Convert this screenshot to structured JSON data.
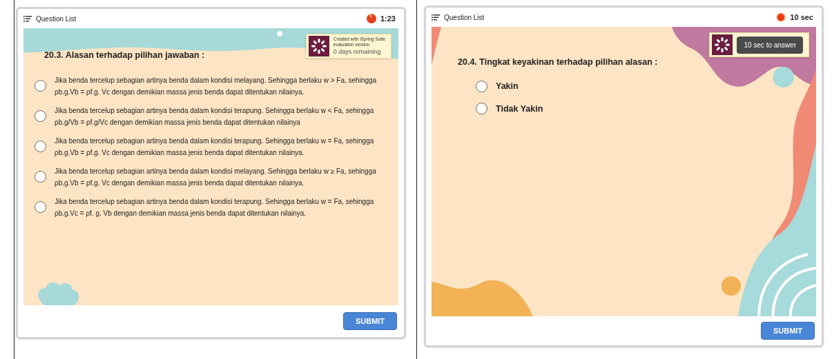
{
  "panels": [
    {
      "kind": "beach",
      "header": {
        "title": "Question List",
        "timer": "1:23",
        "kind": "pie"
      },
      "question": "20.3. Alasan terhadap pilihan jawaban :",
      "badge": {
        "lines": [
          "Created with iSpring Suite",
          "evaluation version",
          "0 days remaining"
        ]
      },
      "options": [
        {
          "text": "Jika benda tercelup sebagian artinya benda dalam kondisi melayang. Sehingga berlaku w > Fa, sehingga ρb.g.Vb = ρf.g. Vc dengan demikian massa jenis benda dapat ditentukan nilainya.",
          "selected": false
        },
        {
          "text": "Jika benda tercelup sebagian artinya benda dalam kondisi terapung. Sehingga berlaku w < Fa, sehingga ρb.g/Vb = ρf.g/Vc dengan demikian massa jenis benda dapat ditentukan nilainya",
          "selected": false
        },
        {
          "text": "Jika benda tercelup sebagian artinya benda dalam kondisi terapung. Sehingga berlaku w = Fa, sehingga ρb.g.Vb = ρf.g. Vc dengan demikian massa jenis benda dapat ditentukan nilainya.",
          "selected": false
        },
        {
          "text": "Jika benda tercelup sebagian artinya benda dalam kondisi melayang. Sehingga berlaku w ≥ Fa, sehingga ρb.g.Vb = ρf.g. Vc dengan demikian massa jenis benda dapat ditentukan nilainya.",
          "selected": false
        },
        {
          "text": "Jika benda tercelup sebagian artinya benda dalam kondisi terapung. Sehingga berlaku w = Fa, sehingga ρb.g.Vc = ρf. g. Vb dengan demikian massa jenis benda dapat ditentukan nilainya.",
          "selected": false
        }
      ],
      "submit": "SUBMIT"
    },
    {
      "kind": "blobs",
      "header": {
        "title": "Question List",
        "timer": "10 sec",
        "kind": "dot"
      },
      "question": "20.4. Tingkat keyakinan terhadap pilihan alasan :",
      "badge": {
        "tooltip": "10 sec to answer"
      },
      "options": [
        {
          "text": "Yakin",
          "selected": false
        },
        {
          "text": "Tidak Yakin",
          "selected": false
        }
      ],
      "submit": "SUBMIT"
    }
  ]
}
